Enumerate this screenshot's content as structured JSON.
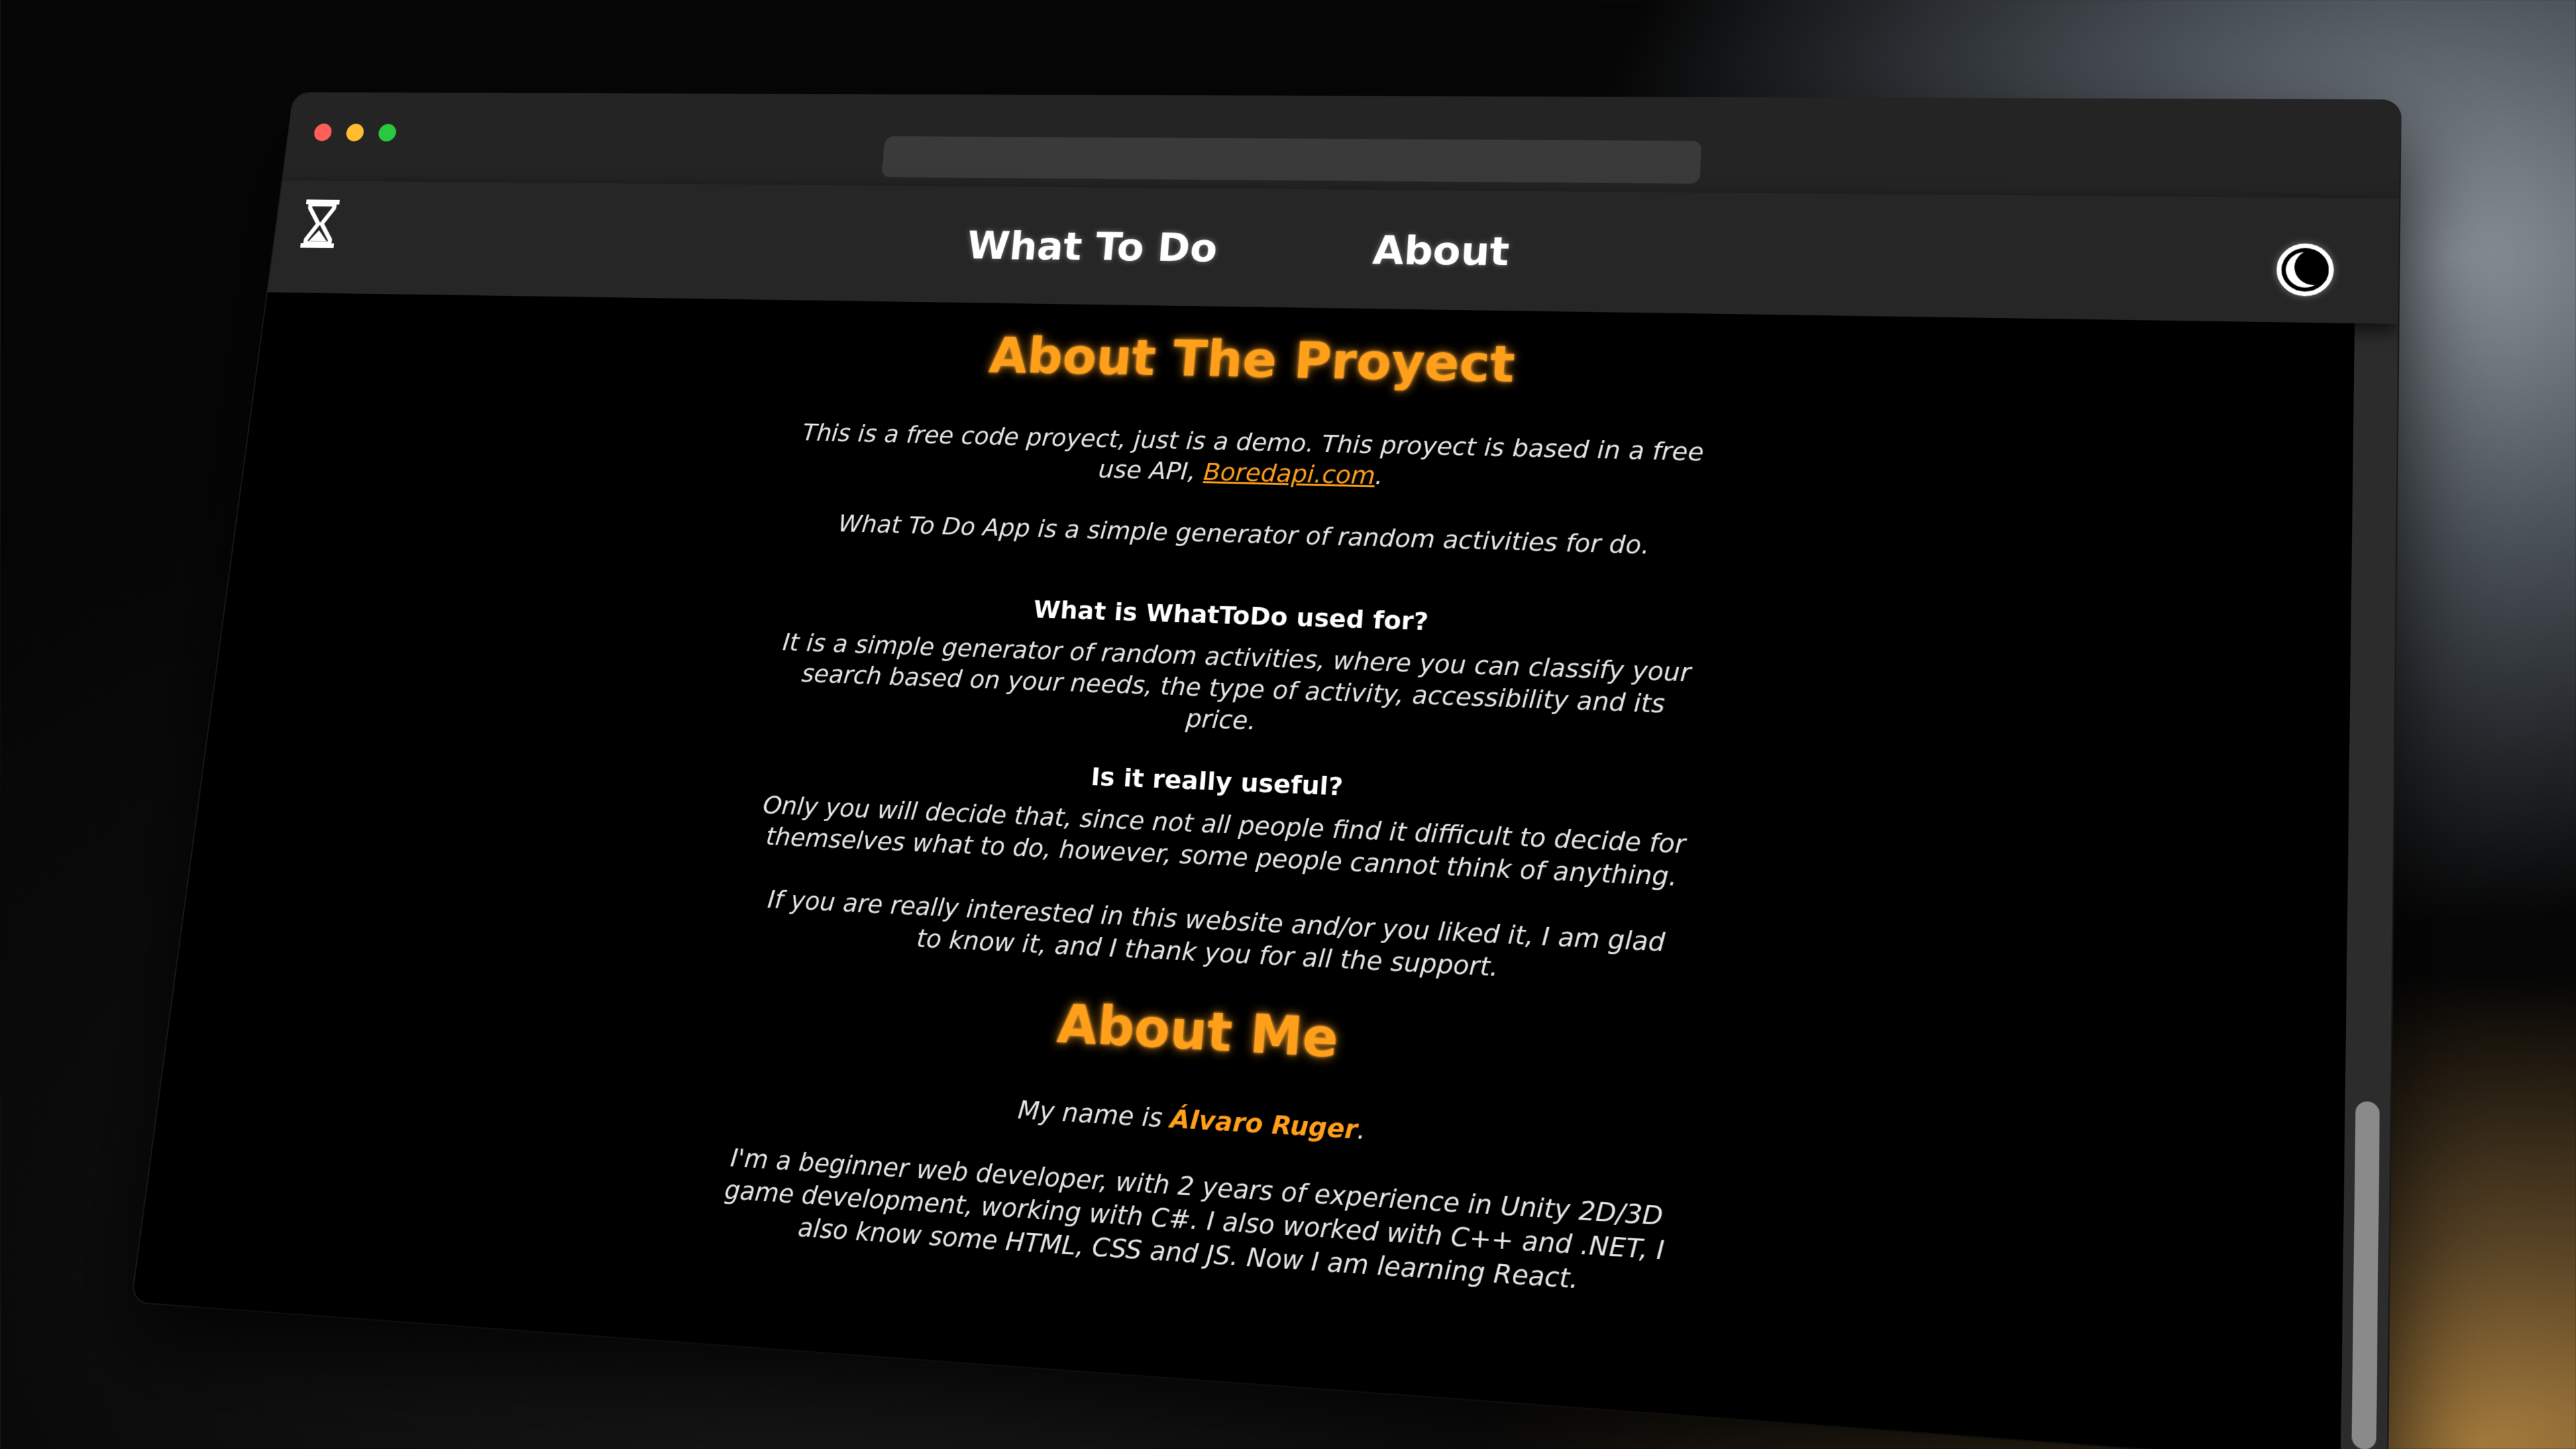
{
  "nav": {
    "links": [
      "What To Do",
      "About"
    ]
  },
  "about_project": {
    "title": "About The Proyect",
    "intro_before_link": "This is a free code proyect, just is a demo. This proyect is based in a free use API,",
    "link_text": "Boredapi.com",
    "intro_after_link": ".",
    "summary": "What To Do App is a simple generator of random activities for do.",
    "q1": "What is WhatToDo used for?",
    "a1": "It is a simple generator of random activities, where you can classify your search based on your needs, the type of activity, accessibility and its price.",
    "q2": "Is it really useful?",
    "a2": "Only you will decide that, since not all people find it difficult to decide for themselves what to do, however, some people cannot think of anything.",
    "thanks": "If you are really interested in this website and/or you liked it, I am glad to know it, and I thank you for all the support."
  },
  "about_me": {
    "title": "About Me",
    "name_prefix": "My name is",
    "name": "Álvaro Ruger",
    "name_suffix": ".",
    "bio": "I'm a beginner web developer, with 2 years of experience in Unity 2D/3D game development, working with C#. I also worked with C++ and .NET, I also know some HTML, CSS and JS. Now I am learning React."
  },
  "icons": {
    "logo": "hourglass-icon",
    "theme": "moon-icon"
  },
  "colors": {
    "accent": "#ff9f1a",
    "background": "#000000",
    "navbar": "#262626"
  }
}
